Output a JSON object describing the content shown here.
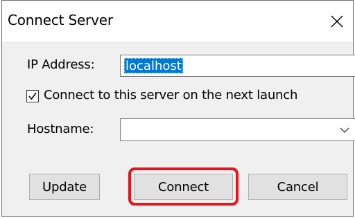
{
  "window": {
    "title": "Connect Server",
    "close_icon": "close-icon"
  },
  "form": {
    "ip_label": "IP Address:",
    "ip_value": "localhost",
    "checkbox_label": "Connect to this server on the next launch",
    "checkbox_checked": true,
    "hostname_label": "Hostname:",
    "hostname_value": ""
  },
  "buttons": {
    "update": "Update",
    "connect": "Connect",
    "cancel": "Cancel"
  },
  "colors": {
    "selection": "#0078d7",
    "highlight": "#e8141b"
  }
}
